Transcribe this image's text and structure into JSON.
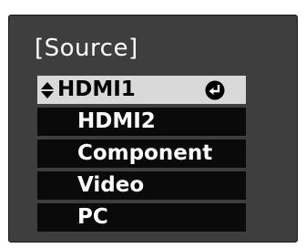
{
  "menu": {
    "title": "[Source]",
    "items": [
      {
        "label": "HDMI1",
        "selected": true,
        "icons": [
          "up-down-arrows-icon",
          "enter-icon"
        ]
      },
      {
        "label": "HDMI2",
        "selected": false
      },
      {
        "label": "Component",
        "selected": false
      },
      {
        "label": "Video",
        "selected": false
      },
      {
        "label": "PC",
        "selected": false
      }
    ]
  },
  "colors": {
    "panel_background": "#3e3e3e",
    "item_background": "#0a0a0a",
    "selected_background": "#d9d9d9",
    "text": "#ffffff",
    "selected_text": "#000000"
  }
}
